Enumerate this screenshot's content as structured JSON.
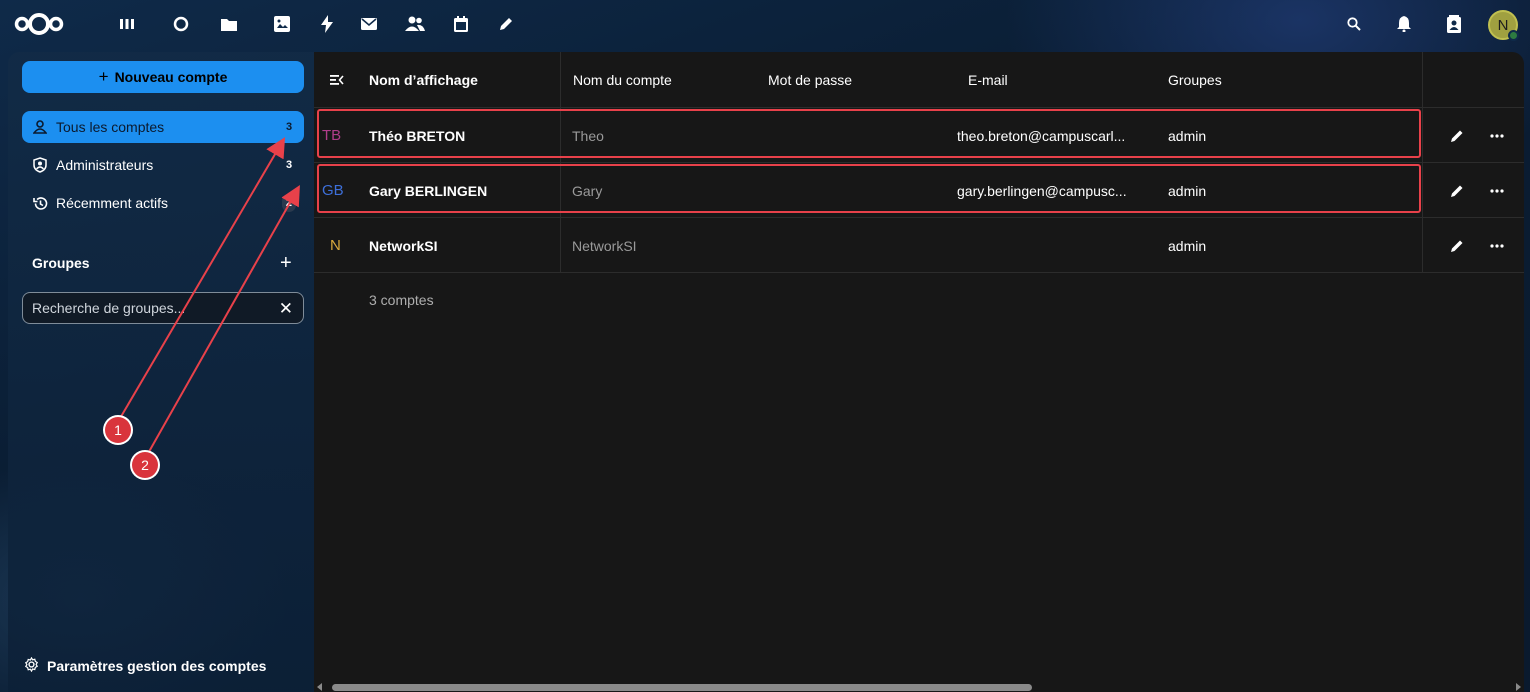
{
  "topbar": {
    "apps": [
      {
        "name": "dashboard-icon"
      },
      {
        "name": "search-app-icon"
      },
      {
        "name": "files-icon"
      },
      {
        "name": "photos-icon"
      },
      {
        "name": "activity-icon"
      },
      {
        "name": "mail-icon"
      },
      {
        "name": "contacts-icon"
      },
      {
        "name": "calendar-icon"
      },
      {
        "name": "notes-icon"
      }
    ],
    "user_initial": "N",
    "accent": "#1c8ff0"
  },
  "sidebar": {
    "new_account_label": "Nouveau compte",
    "items": [
      {
        "label": "Tous les comptes",
        "count": "3",
        "icon": "user-icon",
        "active": true
      },
      {
        "label": "Administrateurs",
        "count": "3",
        "icon": "shield-user-icon",
        "active": false
      },
      {
        "label": "Récemment actifs",
        "count": "2",
        "icon": "history-icon",
        "active": false
      }
    ],
    "groups_title": "Groupes",
    "groups_search_placeholder": "Recherche de groupes...",
    "settings_label": "Paramètres gestion des comptes"
  },
  "table": {
    "columns": {
      "display_name": "Nom d’affichage",
      "account_name": "Nom du compte",
      "password": "Mot de passe",
      "email": "E-mail",
      "groups": "Groupes"
    },
    "rows": [
      {
        "initials": "TB",
        "initials_color": "#b03d8a",
        "display_name": "Théo BRETON",
        "account_name": "Theo",
        "email": "theo.breton@campuscarl...",
        "groups": "admin"
      },
      {
        "initials": "GB",
        "initials_color": "#3d6fd9",
        "display_name": "Gary BERLINGEN",
        "account_name": "Gary",
        "email": "gary.berlingen@campusc...",
        "groups": "admin"
      },
      {
        "initials": "N",
        "initials_color": "#d9a93d",
        "display_name": "NetworkSI",
        "account_name": "NetworkSI",
        "email": "",
        "groups": "admin"
      }
    ],
    "count_text": "3 comptes"
  },
  "annotations": {
    "badge1": "1",
    "badge2": "2",
    "color": "#e8414a"
  }
}
